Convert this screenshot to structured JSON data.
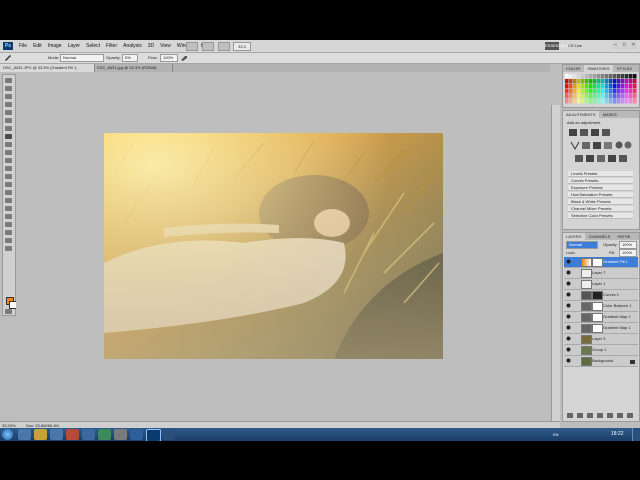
{
  "menu": {
    "app_badge": "Ps",
    "items": [
      "File",
      "Edit",
      "Image",
      "Layer",
      "Select",
      "Filter",
      "Analysis",
      "3D",
      "View",
      "Window",
      "Help"
    ],
    "zoom": "33.3",
    "workspace": "ESSENTIALS",
    "cs_live": "CS Live",
    "window_controls": [
      "–",
      "□",
      "×"
    ]
  },
  "options": {
    "mode_label": "Mode:",
    "mode_value": "Normal",
    "opacity_label": "Opacity:",
    "opacity_value": "5%",
    "flow_label": "Flow:",
    "flow_value": "100%"
  },
  "tabs": [
    {
      "label": "DSC_8431.JPG @ 33.3% (Gradient Fill 1, RGB/8)",
      "active": true
    },
    {
      "label": "DSC_8431.jpg @ 33.3% (RGB/8)",
      "active": false
    }
  ],
  "status": {
    "zoom": "33.33%",
    "doc": "Doc: 23.6M/66.1M"
  },
  "panels": {
    "swatches_tabs": [
      "COLOR",
      "SWATCHES",
      "STYLES"
    ],
    "adjustments_tabs": [
      "ADJUSTMENTS",
      "MASKS"
    ],
    "adjustments_header": "Add an adjustment",
    "presets": [
      "Levels Presets",
      "Curves Presets",
      "Exposure Presets",
      "Hue/Saturation Presets",
      "Black & White Presets",
      "Channel Mixer Presets",
      "Selective Color Presets"
    ],
    "layers_tabs": [
      "LAYERS",
      "CHANNELS",
      "PATHS"
    ],
    "blend_mode": "Normal",
    "opacity_label": "Opacity:",
    "opacity_value": "100%",
    "fill_label": "Fill:",
    "fill_value": "100%",
    "lock_label": "Lock:",
    "layers": [
      {
        "name": "Gradient Fill 1",
        "selected": true,
        "mask": true
      },
      {
        "name": "Layer 7",
        "selected": false,
        "mask": false
      },
      {
        "name": "Layer 1",
        "selected": false,
        "mask": false
      },
      {
        "name": "Curves 1",
        "selected": false,
        "mask": true
      },
      {
        "name": "Color Balance 1",
        "selected": false,
        "mask": true
      },
      {
        "name": "Gradient Map 2",
        "selected": false,
        "mask": true
      },
      {
        "name": "Gradient Map 1",
        "selected": false,
        "mask": true
      },
      {
        "name": "Layer 3",
        "selected": false,
        "mask": false
      },
      {
        "name": "Group 1",
        "selected": false,
        "mask": false
      },
      {
        "name": "Background",
        "selected": false,
        "mask": false
      }
    ]
  },
  "taskbar": {
    "tray_lang": "EN",
    "time": "18:22"
  },
  "colors": {
    "foreground": "#e8891b",
    "background": "#ffffff",
    "selection": "#3d7dd8"
  }
}
